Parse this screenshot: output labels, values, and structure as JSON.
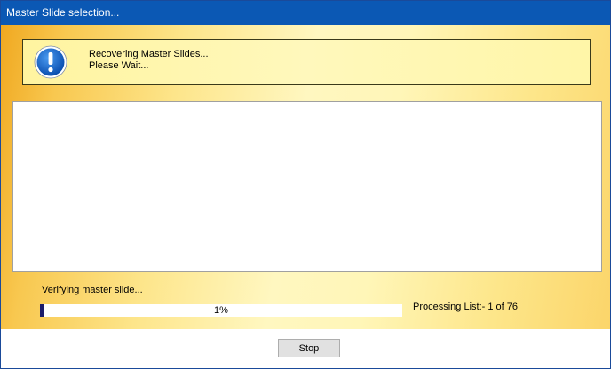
{
  "window": {
    "title": "Master Slide selection..."
  },
  "info": {
    "line1": "Recovering Master Slides...",
    "line2": "Please Wait...",
    "icon": "exclamation-circle-icon"
  },
  "status": {
    "label": "Verifying master slide...",
    "progress_percent": 1,
    "progress_text": "1%",
    "processing_text": "Processing List:- 1 of 76"
  },
  "buttons": {
    "stop_label": "Stop"
  },
  "colors": {
    "titlebar": "#0b58b4",
    "progress_fill": "#1c1c6a",
    "icon_blue": "#1560c8"
  }
}
